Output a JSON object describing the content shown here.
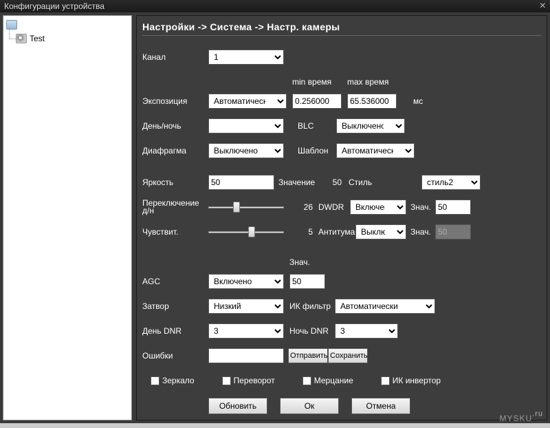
{
  "window": {
    "title": "Конфигурации устройства"
  },
  "sidebar": {
    "root_icon": "device",
    "items": [
      {
        "label": "Test"
      }
    ]
  },
  "breadcrumb": "Настройки -> Система -> Настр. камеры",
  "labels": {
    "channel": "Канал",
    "exposure": "Экспозиция",
    "min_time": "min время",
    "max_time": "max время",
    "ms": "мс",
    "day_night": "День/ночь",
    "blc": "BLC",
    "aperture": "Диафрагма",
    "template": "Шаблон",
    "brightness": "Яркость",
    "value": "Значение",
    "style": "Стиль",
    "switch_dn": "Переключение д/н",
    "dwdr": "DWDR",
    "val_short": "Знач.",
    "sensitivity": "Чувствит.",
    "antifog": "Антитума",
    "agc": "AGC",
    "shutter": "Затвор",
    "ir_filter": "ИК фильтр",
    "day_dnr": "День DNR",
    "night_dnr": "Ночь DNR",
    "errors": "Ошибки",
    "mirror": "Зеркало",
    "flip": "Переворот",
    "flicker": "Мерцание",
    "ir_invert": "ИК инвертор"
  },
  "fields": {
    "channel": "1",
    "exposure": "Автоматически",
    "min_time": "0.256000",
    "max_time": "65.536000",
    "day_night": "",
    "blc": "Выключено",
    "aperture": "Выключено",
    "template": "Автоматически",
    "brightness": "50",
    "brightness_val": "50",
    "style": "стиль2",
    "switch_dn_val": "26",
    "dwdr": "Включено",
    "dwdr_val": "50",
    "sensitivity_val": "5",
    "antifog": "Выключен",
    "antifog_val": "50",
    "agc": "Включено",
    "agc_val": "50",
    "shutter": "Низкий",
    "ir_filter": "Автоматически",
    "day_dnr": "3",
    "night_dnr": "3",
    "errors": ""
  },
  "buttons": {
    "send": "Отправить",
    "save": "Сохранить",
    "refresh": "Обновить",
    "ok": "Ок",
    "cancel": "Отмена"
  },
  "watermark": {
    "main": "MYSKU",
    "domain": ".ru"
  }
}
